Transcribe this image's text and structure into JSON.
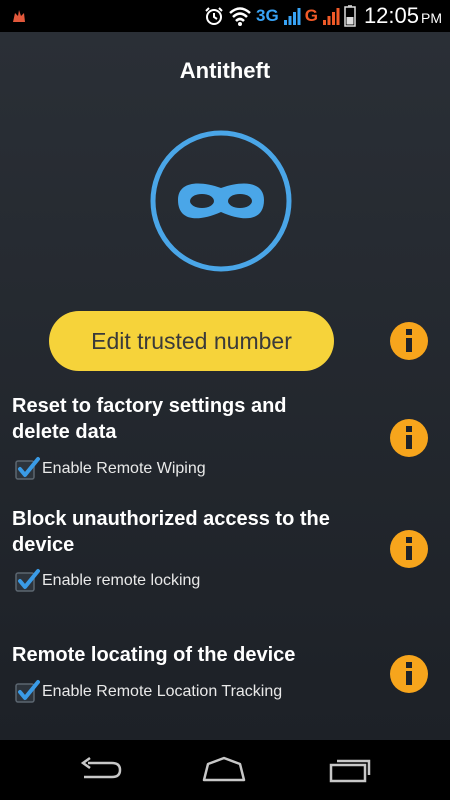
{
  "status_bar": {
    "network_3g": "3G",
    "network_g": "G",
    "time": "12:05",
    "ampm": "PM",
    "icons": [
      "app-icon",
      "alarm-icon",
      "wifi-icon",
      "signal-icon",
      "battery-icon"
    ]
  },
  "header": {
    "title": "Antitheft"
  },
  "trusted_button": {
    "label": "Edit trusted number"
  },
  "sections": [
    {
      "title_line1": "Reset to factory settings and",
      "title_line2": "delete data",
      "checkbox_label": "Enable Remote Wiping",
      "checked": true
    },
    {
      "title_line1": "Block unauthorized access to the",
      "title_line2": "device",
      "checkbox_label": "Enable remote locking",
      "checked": true
    },
    {
      "title_line1": "Remote locating of the device",
      "title_line2": "",
      "checkbox_label": "Enable Remote Location Tracking",
      "checked": true
    }
  ],
  "colors": {
    "accent_yellow": "#f6d33a",
    "info_orange": "#f7a51c",
    "logo_blue": "#4aa6e8",
    "check_blue": "#3a9be6"
  },
  "nav": {
    "icons": [
      "back-icon",
      "home-icon",
      "recent-apps-icon"
    ]
  }
}
